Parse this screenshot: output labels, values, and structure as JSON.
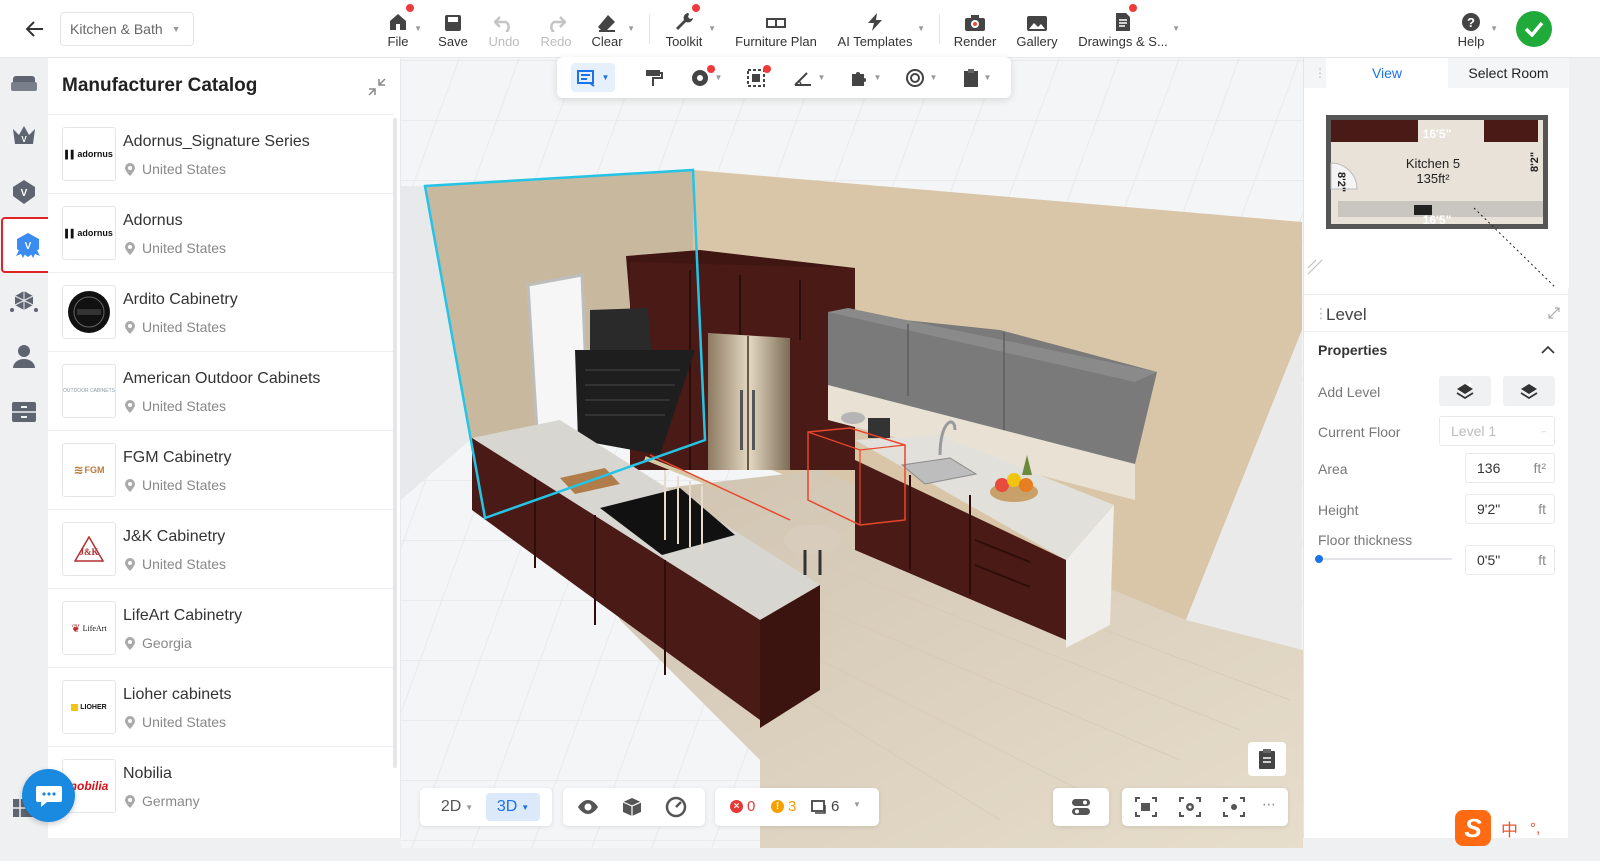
{
  "header": {
    "project_name": "Kitchen & Bath",
    "tools": {
      "file": "File",
      "save": "Save",
      "undo": "Undo",
      "redo": "Redo",
      "clear": "Clear",
      "toolkit": "Toolkit",
      "furniture_plan": "Furniture Plan",
      "ai_templates": "AI Templates",
      "render": "Render",
      "gallery": "Gallery",
      "drawings": "Drawings & S...",
      "help": "Help"
    }
  },
  "catalog": {
    "title": "Manufacturer Catalog",
    "items": [
      {
        "name": "Adornus_Signature Series",
        "location": "United States",
        "logo_text": "adornus"
      },
      {
        "name": "Adornus",
        "location": "United States",
        "logo_text": "adornus"
      },
      {
        "name": "Ardito Cabinetry",
        "location": "United States",
        "logo_text": ""
      },
      {
        "name": "American Outdoor Cabinets",
        "location": "United States",
        "logo_text": "OUTDOOR CABINETS"
      },
      {
        "name": "FGM Cabinetry",
        "location": "United States",
        "logo_text": "FGM"
      },
      {
        "name": "J&K Cabinetry",
        "location": "United States",
        "logo_text": "J&K"
      },
      {
        "name": "LifeArt Cabinetry",
        "location": "Georgia",
        "logo_text": "LifeArt"
      },
      {
        "name": "Lioher cabinets",
        "location": "United States",
        "logo_text": "LIOHER"
      },
      {
        "name": "Nobilia",
        "location": "Germany",
        "logo_text": "nobilia"
      }
    ]
  },
  "viewport": {
    "view_2d": "2D",
    "view_3d": "3D",
    "errors": "0",
    "warnings": "3",
    "items": "6"
  },
  "right_panel": {
    "tab_view": "View",
    "tab_select_room": "Select Room",
    "minimap": {
      "room_name": "Kitchen 5",
      "room_area": "135ft²",
      "dim_top": "16'5\"",
      "dim_bottom": "16'5\"",
      "dim_left": "8'2\"",
      "dim_right": "8'2\""
    },
    "level_title": "Level",
    "properties_title": "Properties",
    "add_level_label": "Add Level",
    "current_floor_label": "Current Floor",
    "current_floor_value": "Level 1",
    "area_label": "Area",
    "area_value": "136",
    "area_unit": "ft²",
    "height_label": "Height",
    "height_value": "9'2\"",
    "height_unit": "ft",
    "floor_thickness_label": "Floor thickness",
    "floor_thickness_value": "0'5\"",
    "floor_thickness_unit": "ft",
    "floor_thickness_slider": 0
  },
  "ime": {
    "logo": "S",
    "mode": "中",
    "punct": "°,"
  },
  "colors": {
    "accent": "#1a73e8",
    "highlight": "#e02424",
    "success": "#1faa3a",
    "notify": "#f03a3a",
    "cabinet": "#4a1a16",
    "wall": "#d9c6a8"
  }
}
